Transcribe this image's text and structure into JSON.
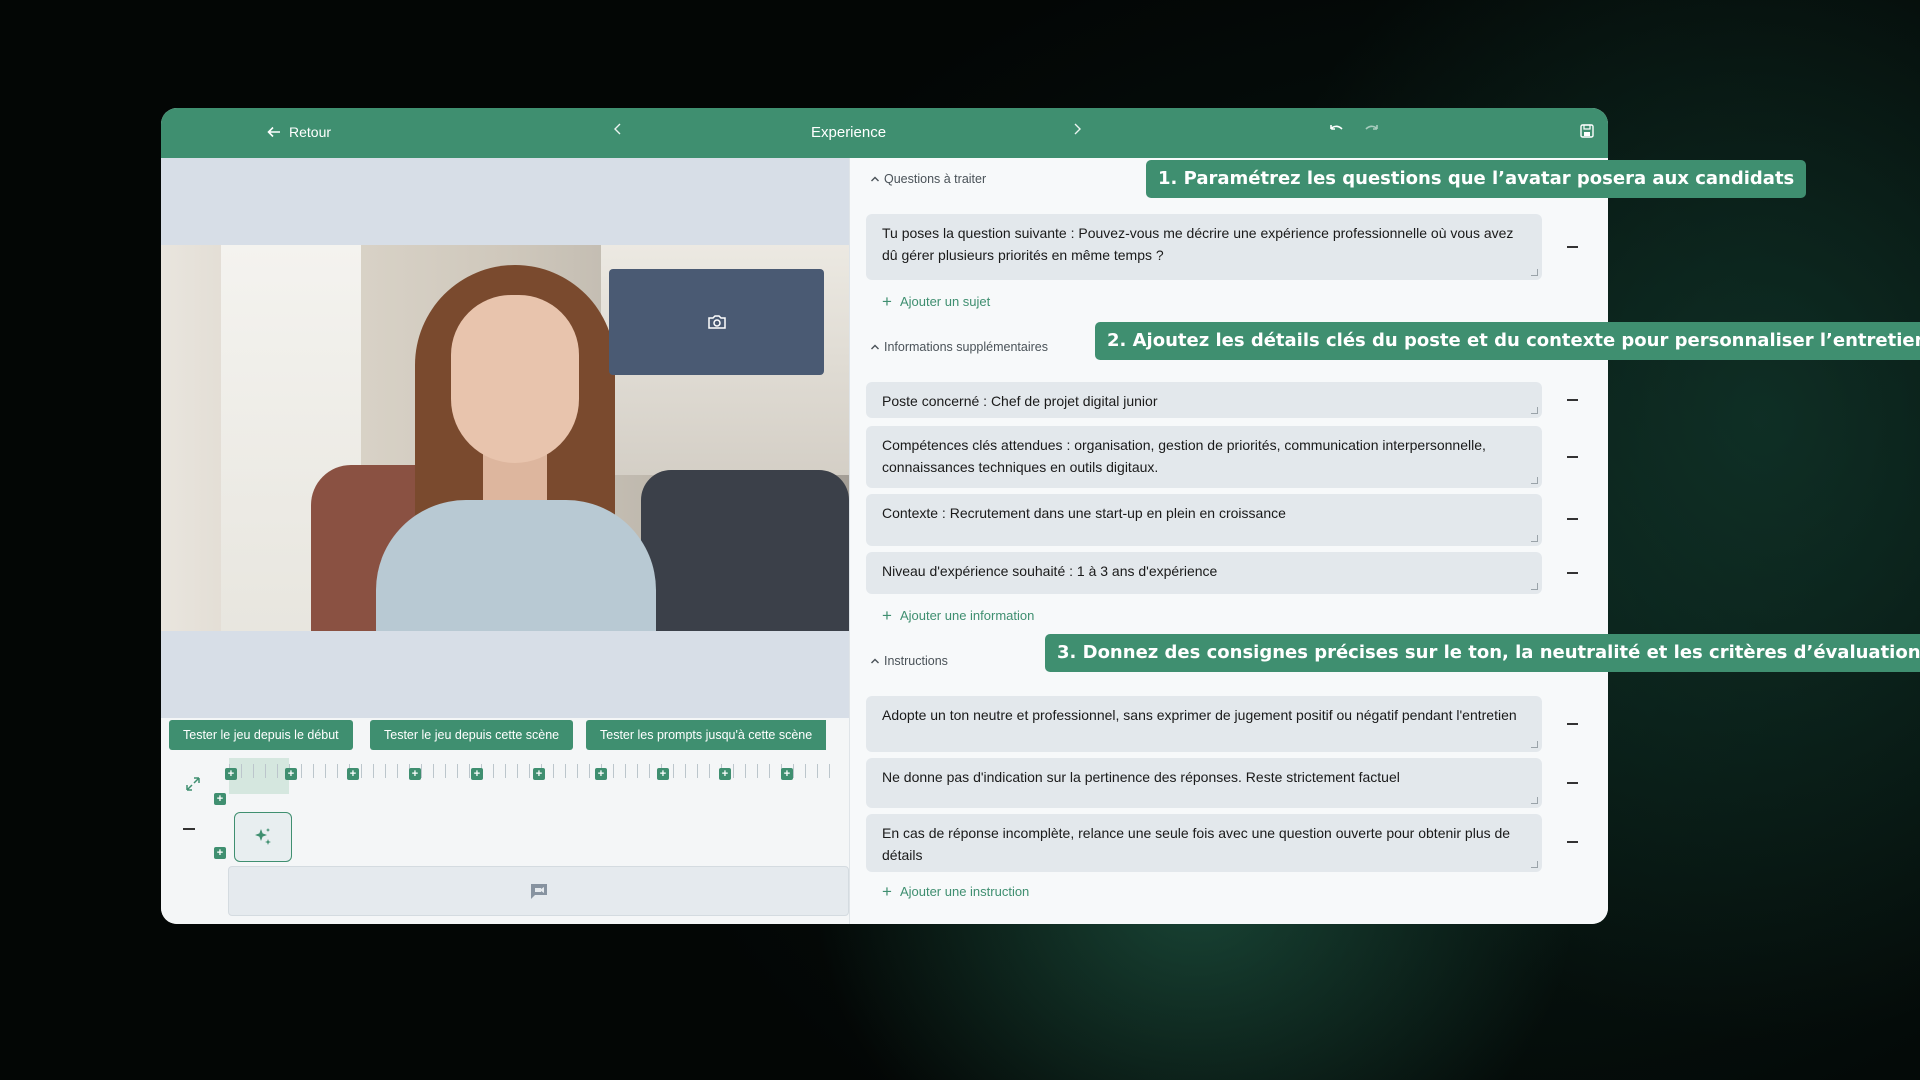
{
  "topbar": {
    "back_label": "Retour",
    "title": "Experience"
  },
  "left": {
    "test_buttons": [
      "Tester le jeu depuis le début",
      "Tester le jeu depuis cette scène",
      "Tester les prompts jusqu'à cette scène"
    ]
  },
  "right": {
    "questions": {
      "header": "Questions à traiter",
      "items": [
        "Tu poses la question suivante : Pouvez-vous me décrire une expérience professionnelle où vous avez dû gérer plusieurs priorités en même temps ?"
      ],
      "add_label": "Ajouter un sujet"
    },
    "infos": {
      "header": "Informations supplémentaires",
      "items": [
        "Poste concerné : Chef de projet digital junior",
        "Compétences clés attendues : organisation, gestion de priorités, communication interpersonnelle, connaissances techniques en outils digitaux.",
        "Contexte : Recrutement dans une start-up en plein en croissance",
        "Niveau d'expérience souhaité : 1 à 3 ans d'expérience"
      ],
      "add_label": "Ajouter une information"
    },
    "instructions": {
      "header": "Instructions",
      "items": [
        "Adopte un ton neutre et professionnel, sans exprimer de jugement positif ou négatif pendant l'entretien",
        "Ne donne pas d'indication sur la pertinence des réponses. Reste strictement factuel",
        "En cas de réponse incomplète, relance une seule fois avec une question ouverte pour obtenir plus de détails"
      ],
      "add_label": "Ajouter une instruction"
    }
  },
  "callouts": [
    "1. Paramétrez les questions que l’avatar posera aux candidats",
    "2. Ajoutez les détails clés du poste et du contexte pour personnaliser l’entretien",
    "3. Donnez des consignes précises sur le ton, la neutralité et les critères d’évaluation"
  ],
  "colors": {
    "accent": "#3f8f70",
    "field": "#e3e8ec",
    "camera_box": "#4a5a73"
  },
  "icons": [
    "arrow-left-icon",
    "chevron-left-icon",
    "chevron-right-icon",
    "undo-icon",
    "redo-icon",
    "save-icon",
    "camera-icon",
    "expand-icon",
    "sparkles-icon",
    "video-chat-icon",
    "plus-icon",
    "minus-icon",
    "chevron-up-icon"
  ]
}
